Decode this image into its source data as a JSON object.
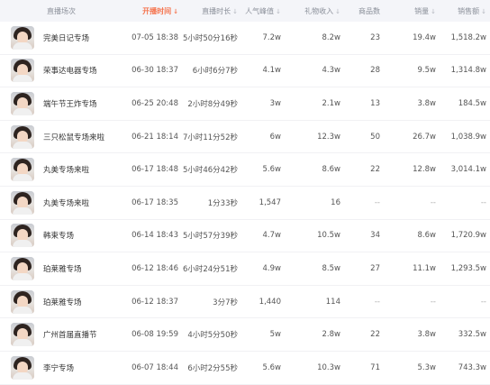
{
  "headers": {
    "name": "直播场次",
    "start": "开播时间",
    "duration": "直播时长",
    "peak": "人气峰值",
    "gift": "礼物收入",
    "goods": "商品数",
    "sales": "销量",
    "amount": "销售额"
  },
  "sort_icon": "sort-arrow-icon",
  "accent_color": "#f5734d",
  "rows": [
    {
      "name": "完美日记专场",
      "start": "07-05 18:38",
      "duration": "5小时50分16秒",
      "peak": "7.2w",
      "gift": "8.2w",
      "goods": "23",
      "sales": "19.4w",
      "amount": "1,518.2w"
    },
    {
      "name": "荣事达电器专场",
      "start": "06-30 18:37",
      "duration": "6小时6分7秒",
      "peak": "4.1w",
      "gift": "4.3w",
      "goods": "28",
      "sales": "9.5w",
      "amount": "1,314.8w"
    },
    {
      "name": "端午节王炸专场",
      "start": "06-25 20:48",
      "duration": "2小时8分49秒",
      "peak": "3w",
      "gift": "2.1w",
      "goods": "13",
      "sales": "3.8w",
      "amount": "184.5w"
    },
    {
      "name": "三只松鼠专场来啦",
      "start": "06-21 18:14",
      "duration": "7小时11分52秒",
      "peak": "6w",
      "gift": "12.3w",
      "goods": "50",
      "sales": "26.7w",
      "amount": "1,038.9w"
    },
    {
      "name": "丸美专场来啦",
      "start": "06-17 18:48",
      "duration": "5小时46分42秒",
      "peak": "5.6w",
      "gift": "8.6w",
      "goods": "22",
      "sales": "12.8w",
      "amount": "3,014.1w"
    },
    {
      "name": "丸美专场来啦",
      "start": "06-17 18:35",
      "duration": "1分33秒",
      "peak": "1,547",
      "gift": "16",
      "goods": "--",
      "sales": "--",
      "amount": "--"
    },
    {
      "name": "韩束专场",
      "start": "06-14 18:43",
      "duration": "5小时57分39秒",
      "peak": "4.7w",
      "gift": "10.5w",
      "goods": "34",
      "sales": "8.6w",
      "amount": "1,720.9w"
    },
    {
      "name": "珀莱雅专场",
      "start": "06-12 18:46",
      "duration": "6小时24分51秒",
      "peak": "4.9w",
      "gift": "8.5w",
      "goods": "27",
      "sales": "11.1w",
      "amount": "1,293.5w"
    },
    {
      "name": "珀莱雅专场",
      "start": "06-12 18:37",
      "duration": "3分7秒",
      "peak": "1,440",
      "gift": "114",
      "goods": "--",
      "sales": "--",
      "amount": "--"
    },
    {
      "name": "广州首届直播节",
      "start": "06-08 19:59",
      "duration": "4小时5分50秒",
      "peak": "5w",
      "gift": "2.8w",
      "goods": "22",
      "sales": "3.8w",
      "amount": "332.5w"
    },
    {
      "name": "李宁专场",
      "start": "06-07 18:44",
      "duration": "6小时2分55秒",
      "peak": "5.6w",
      "gift": "10.3w",
      "goods": "71",
      "sales": "5.3w",
      "amount": "743.3w"
    }
  ]
}
